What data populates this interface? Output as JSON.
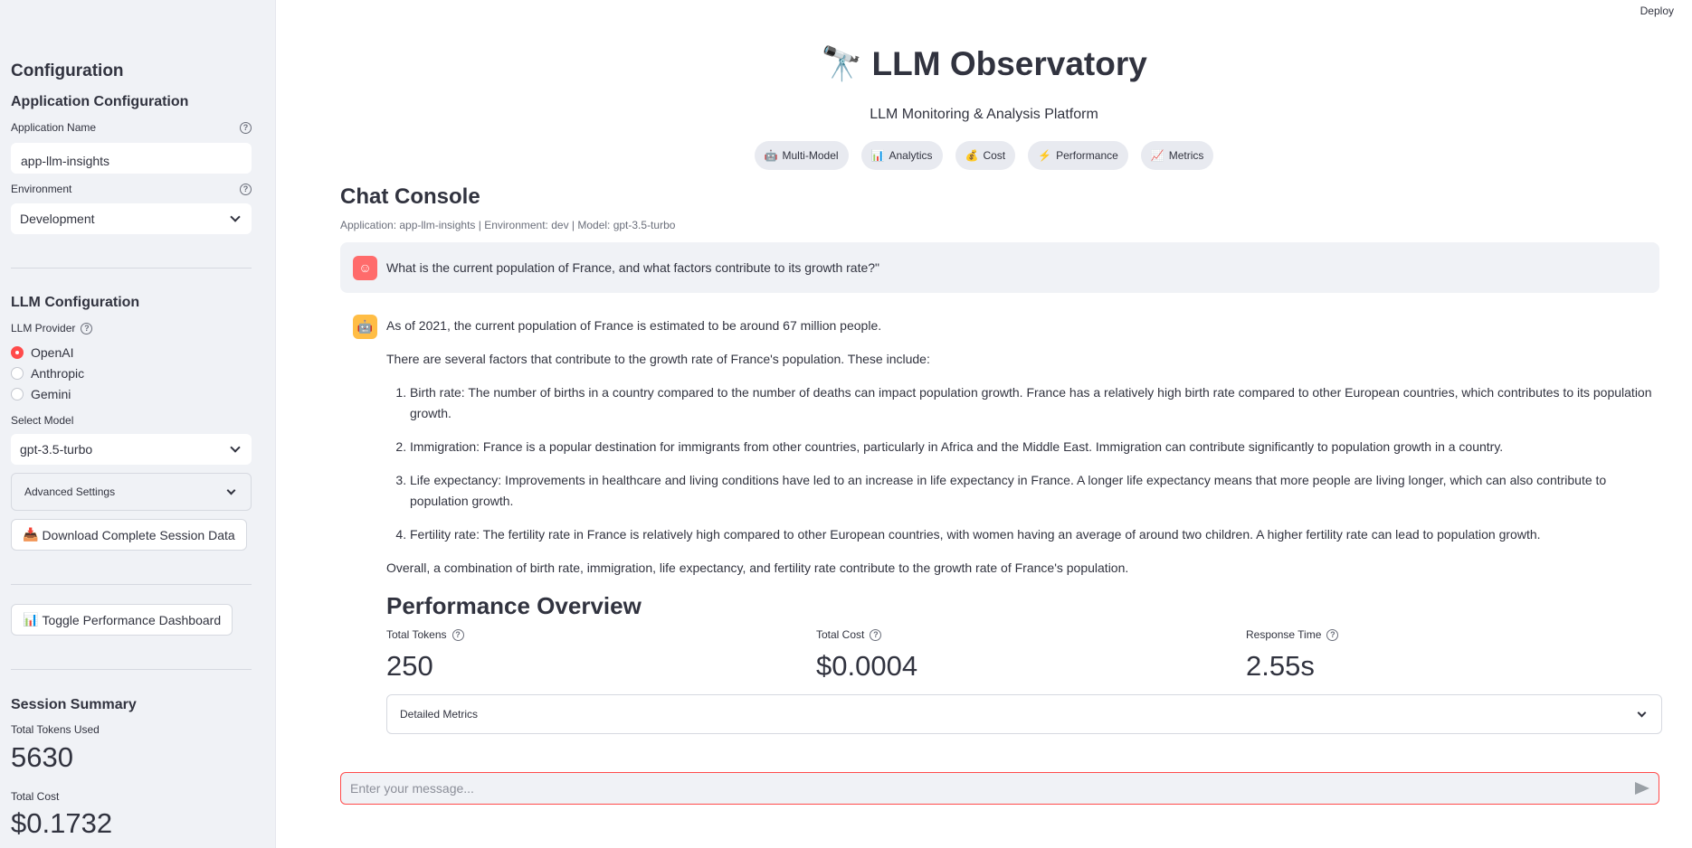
{
  "topbar": {
    "deploy_label": "Deploy"
  },
  "sidebar": {
    "configuration_title": "Configuration",
    "app_config_title": "Application Configuration",
    "app_name_label": "Application Name",
    "app_name_value": "app-llm-insights",
    "environment_label": "Environment",
    "environment_value": "Development",
    "llm_config_title": "LLM Configuration",
    "llm_provider_label": "LLM Provider",
    "providers": [
      "OpenAI",
      "Anthropic",
      "Gemini"
    ],
    "selected_provider": "OpenAI",
    "select_model_label": "Select Model",
    "model_value": "gpt-3.5-turbo",
    "advanced_settings_label": "Advanced Settings",
    "download_button_label": "Download Complete Session Data",
    "toggle_dashboard_label": "Toggle Performance Dashboard",
    "session_summary_title": "Session Summary",
    "total_tokens_used_label": "Total Tokens Used",
    "total_tokens_used_value": "5630",
    "total_cost_label": "Total Cost",
    "total_cost_value": "$0.1732"
  },
  "header": {
    "title": "LLM Observatory",
    "title_emoji": "🔭",
    "subtitle": "LLM Monitoring & Analysis Platform",
    "pills": [
      {
        "emoji": "🤖",
        "label": "Multi-Model"
      },
      {
        "emoji": "📊",
        "label": "Analytics"
      },
      {
        "emoji": "💰",
        "label": "Cost"
      },
      {
        "emoji": "⚡",
        "label": "Performance"
      },
      {
        "emoji": "📈",
        "label": "Metrics"
      }
    ]
  },
  "chat": {
    "title": "Chat Console",
    "caption": "Application: app-llm-insights | Environment: dev | Model: gpt-3.5-turbo",
    "user_message": "What is the current population of France, and what factors contribute to its growth rate?\"",
    "bot_intro": "As of 2021, the current population of France is estimated to be around 67 million people.",
    "bot_lead": "There are several factors that contribute to the growth rate of France's population. These include:",
    "bot_items": [
      "Birth rate: The number of births in a country compared to the number of deaths can impact population growth. France has a relatively high birth rate compared to other European countries, which contributes to its population growth.",
      "Immigration: France is a popular destination for immigrants from other countries, particularly in Africa and the Middle East. Immigration can contribute significantly to population growth in a country.",
      "Life expectancy: Improvements in healthcare and living conditions have led to an increase in life expectancy in France. A longer life expectancy means that more people are living longer, which can also contribute to population growth.",
      "Fertility rate: The fertility rate in France is relatively high compared to other European countries, with women having an average of around two children. A higher fertility rate can lead to population growth."
    ],
    "bot_conclusion": "Overall, a combination of birth rate, immigration, life expectancy, and fertility rate contribute to the growth rate of France's population.",
    "input_placeholder": "Enter your message..."
  },
  "performance": {
    "title": "Performance Overview",
    "total_tokens_label": "Total Tokens",
    "total_tokens_value": "250",
    "total_cost_label": "Total Cost",
    "total_cost_value": "$0.0004",
    "response_time_label": "Response Time",
    "response_time_value": "2.55s",
    "detailed_metrics_label": "Detailed Metrics"
  },
  "colors": {
    "accent": "#ff4b4b",
    "sidebar_bg": "#f0f2f6",
    "user_avatar": "#ff6b6b",
    "bot_avatar": "#ffbd45"
  }
}
